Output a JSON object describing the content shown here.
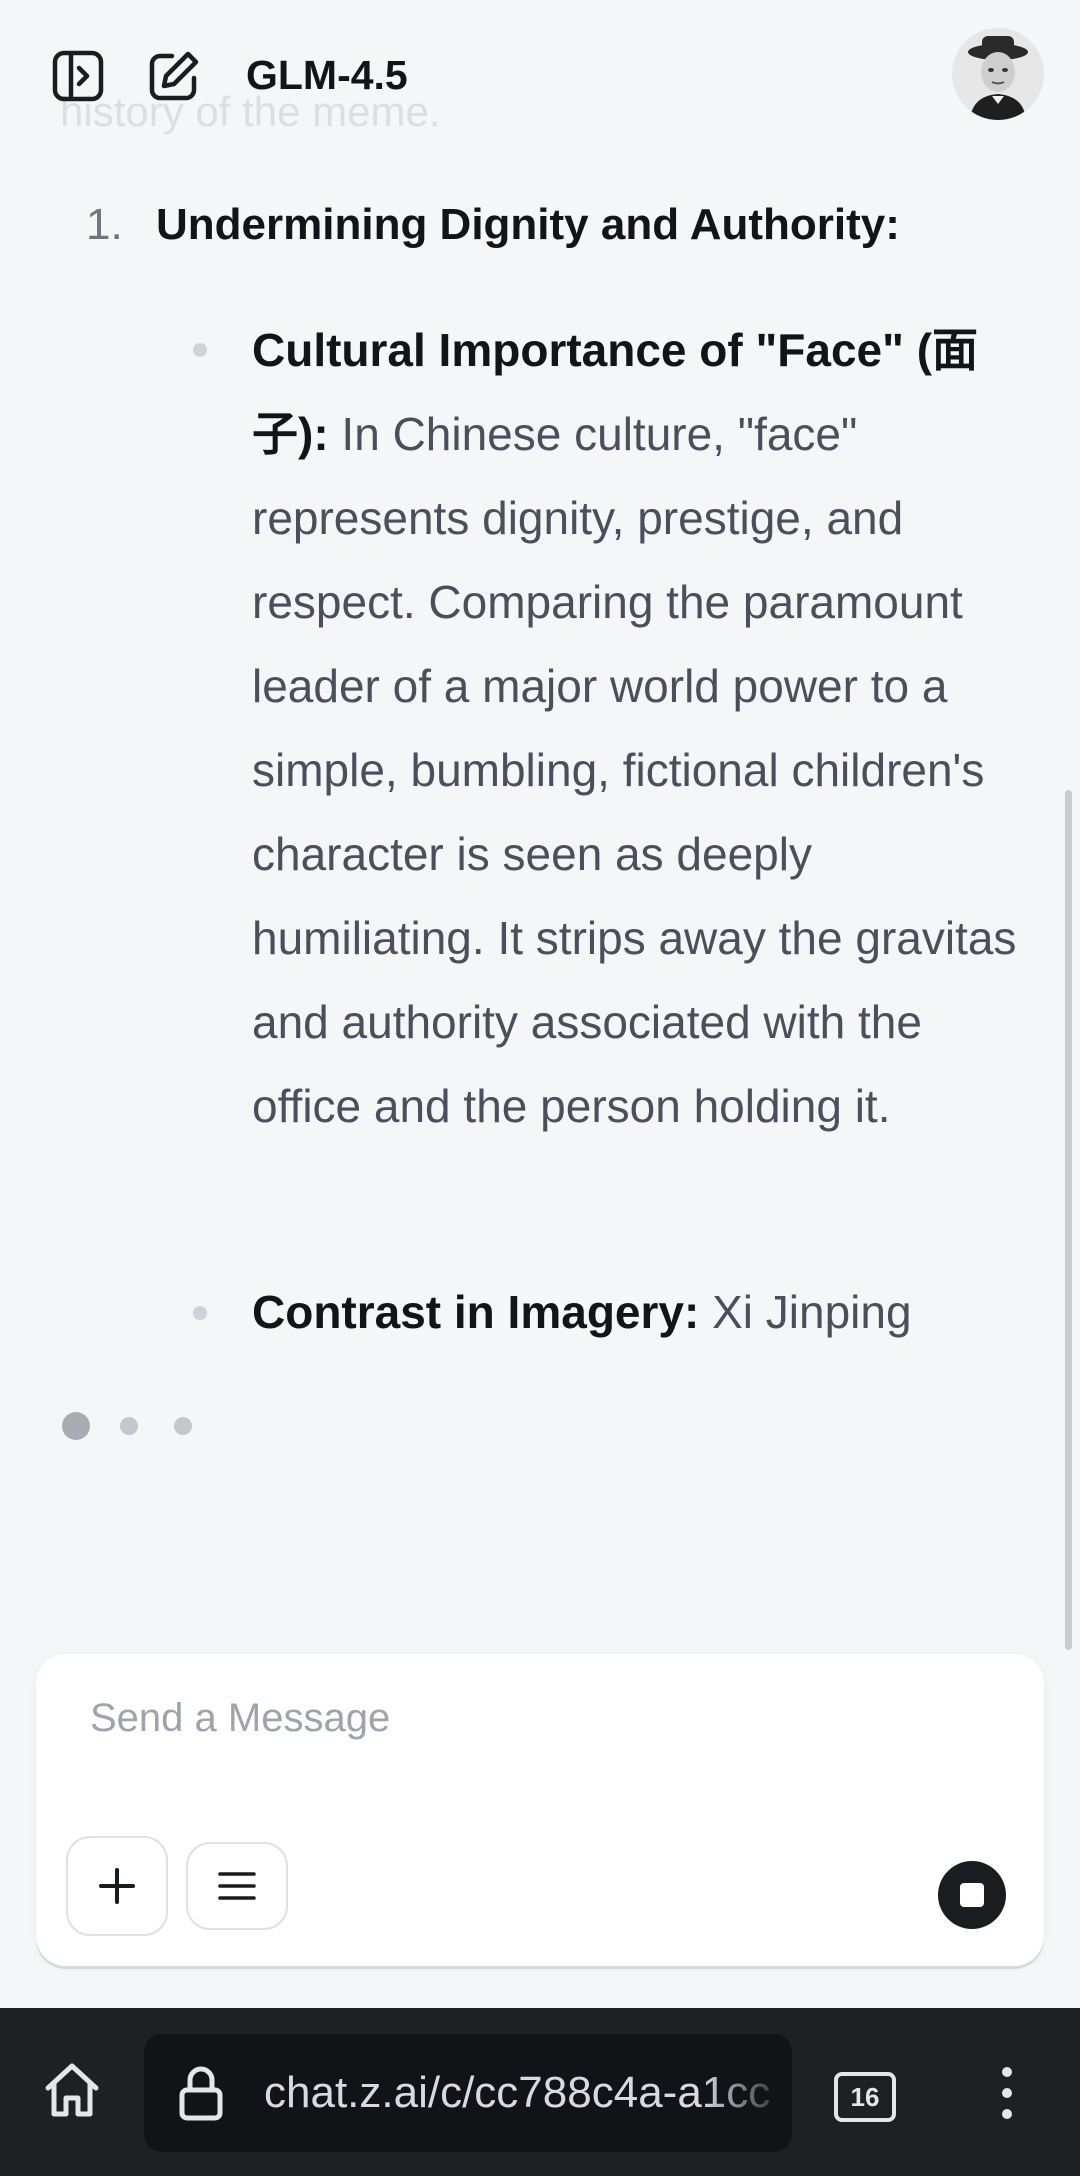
{
  "header": {
    "model_title": "GLM-4.5",
    "faded_text": "history of the meme.",
    "icons": [
      "sidebar-toggle-icon",
      "new-chat-icon"
    ]
  },
  "content": {
    "list_number": "1.",
    "list_heading": "Undermining Dignity and Authority:",
    "bullets": [
      {
        "bold": "Cultural Importance of \"Face\" (面子):",
        "text": " In Chinese culture, \"face\" represents dignity, prestige, and respect. Comparing the paramount leader of a major world power to a simple, bumbling, fictional children's character is seen as deeply humiliating. It strips away the gravitas and authority associated with the office and the person holding it."
      },
      {
        "bold": "Contrast in Imagery:",
        "text": " Xi Jinping"
      }
    ]
  },
  "composer": {
    "placeholder": "Send a Message",
    "icons": [
      "plus-icon",
      "menu-icon",
      "stop-icon"
    ]
  },
  "browser": {
    "url": "chat.z.ai/c/cc788c4a-a1cc",
    "tab_count": "16",
    "icons": [
      "home-icon",
      "lock-icon",
      "more-icon"
    ]
  },
  "colors": {
    "background": "#f5f6f8",
    "browser_bar": "#1f2024",
    "text_primary": "#111418",
    "text_secondary": "#4a4f5b"
  }
}
